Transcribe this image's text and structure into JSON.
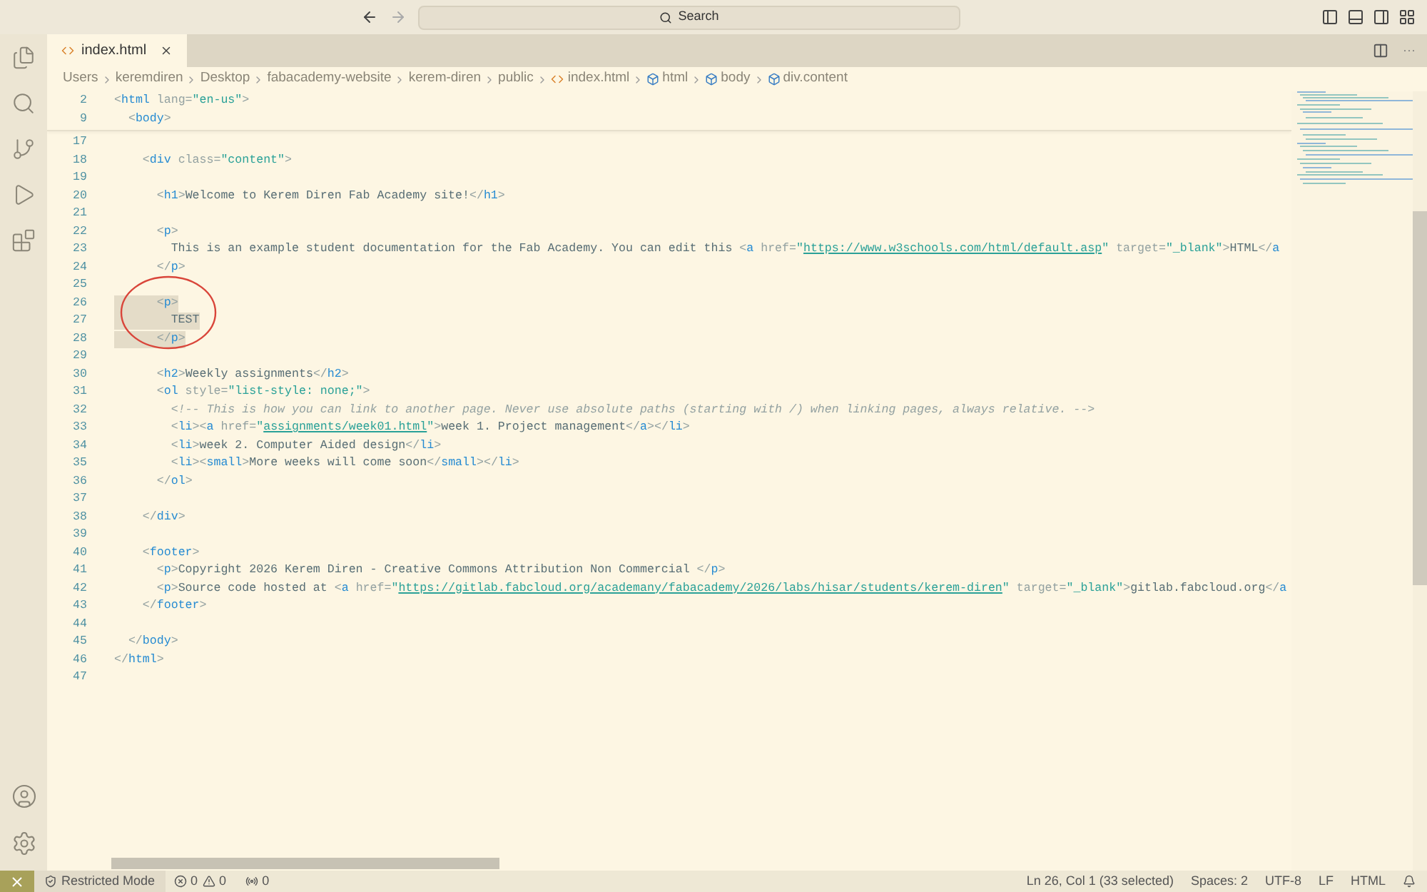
{
  "title_bar": {
    "search": {
      "placeholder": "Search"
    }
  },
  "tabs": [
    {
      "label": "index.html",
      "selected": true
    }
  ],
  "tab_actions": {
    "more": "···"
  },
  "breadcrumbs": [
    {
      "kind": "folder",
      "label": "Users"
    },
    {
      "kind": "folder",
      "label": "keremdiren"
    },
    {
      "kind": "folder",
      "label": "Desktop"
    },
    {
      "kind": "folder",
      "label": "fabacademy-website"
    },
    {
      "kind": "folder",
      "label": "kerem-diren"
    },
    {
      "kind": "folder",
      "label": "public"
    },
    {
      "kind": "file",
      "label": "index.html"
    },
    {
      "kind": "symbol",
      "label": "html"
    },
    {
      "kind": "symbol",
      "label": "body"
    },
    {
      "kind": "symbol",
      "label": "div.content"
    }
  ],
  "sticky_lines": [
    {
      "number": "2",
      "tokens": [
        {
          "kind": "punct",
          "text": "<"
        },
        {
          "kind": "tag",
          "text": "html"
        },
        {
          "kind": "attr",
          "text": " lang="
        },
        {
          "kind": "str",
          "text": "\"en-us\""
        },
        {
          "kind": "punct",
          "text": ">"
        }
      ]
    },
    {
      "number": "9",
      "tokens": [
        {
          "kind": "punct",
          "text": "  <"
        },
        {
          "kind": "tag",
          "text": "body"
        },
        {
          "kind": "punct",
          "text": ">"
        }
      ]
    }
  ],
  "lines": [
    {
      "number": "17",
      "selected": false
    },
    {
      "number": "18",
      "selected": false,
      "tokens": [
        {
          "kind": "punct",
          "text": "    <"
        },
        {
          "kind": "tag",
          "text": "div"
        },
        {
          "kind": "attr",
          "text": " class="
        },
        {
          "kind": "str",
          "text": "\"content\""
        },
        {
          "kind": "punct",
          "text": ">"
        }
      ]
    },
    {
      "number": "19",
      "selected": false
    },
    {
      "number": "20",
      "selected": false,
      "tokens": [
        {
          "kind": "punct",
          "text": "      <"
        },
        {
          "kind": "tag",
          "text": "h1"
        },
        {
          "kind": "punct",
          "text": ">"
        },
        {
          "kind": "text",
          "text": "Welcome to Kerem Diren Fab Academy site!"
        },
        {
          "kind": "punct",
          "text": "</"
        },
        {
          "kind": "tag",
          "text": "h1"
        },
        {
          "kind": "punct",
          "text": ">"
        }
      ]
    },
    {
      "number": "21",
      "selected": false
    },
    {
      "number": "22",
      "selected": false,
      "tokens": [
        {
          "kind": "punct",
          "text": "      <"
        },
        {
          "kind": "tag",
          "text": "p"
        },
        {
          "kind": "punct",
          "text": ">"
        }
      ]
    },
    {
      "number": "23",
      "selected": false,
      "tokens": [
        {
          "kind": "text",
          "text": "        This is an example student documentation for the Fab Academy. You can edit this "
        },
        {
          "kind": "punct",
          "text": "<"
        },
        {
          "kind": "tag",
          "text": "a"
        },
        {
          "kind": "attr",
          "text": " href="
        },
        {
          "kind": "str",
          "text": "\""
        },
        {
          "kind": "link",
          "text": "https://www.w3schools.com/html/default.asp"
        },
        {
          "kind": "str",
          "text": "\""
        },
        {
          "kind": "attr",
          "text": " target="
        },
        {
          "kind": "str",
          "text": "\"_blank\""
        },
        {
          "kind": "punct",
          "text": ">"
        },
        {
          "kind": "text",
          "text": "HTML"
        },
        {
          "kind": "punct",
          "text": "</"
        },
        {
          "kind": "tag",
          "text": "a"
        }
      ]
    },
    {
      "number": "24",
      "selected": false,
      "tokens": [
        {
          "kind": "punct",
          "text": "      </"
        },
        {
          "kind": "tag",
          "text": "p"
        },
        {
          "kind": "punct",
          "text": ">"
        }
      ]
    },
    {
      "number": "25",
      "selected": false
    },
    {
      "number": "26",
      "selected": true,
      "tokens": [
        {
          "kind": "punct",
          "text": "      <"
        },
        {
          "kind": "tag",
          "text": "p"
        },
        {
          "kind": "punct",
          "text": ">"
        }
      ]
    },
    {
      "number": "27",
      "selected": true,
      "tokens": [
        {
          "kind": "text",
          "text": "        TEST"
        }
      ]
    },
    {
      "number": "28",
      "selected": true,
      "tokens": [
        {
          "kind": "punct",
          "text": "      </"
        },
        {
          "kind": "tag",
          "text": "p"
        },
        {
          "kind": "punct",
          "text": ">"
        }
      ]
    },
    {
      "number": "29",
      "selected": false
    },
    {
      "number": "30",
      "selected": false,
      "tokens": [
        {
          "kind": "punct",
          "text": "      <"
        },
        {
          "kind": "tag",
          "text": "h2"
        },
        {
          "kind": "punct",
          "text": ">"
        },
        {
          "kind": "text",
          "text": "Weekly assignments"
        },
        {
          "kind": "punct",
          "text": "</"
        },
        {
          "kind": "tag",
          "text": "h2"
        },
        {
          "kind": "punct",
          "text": ">"
        }
      ]
    },
    {
      "number": "31",
      "selected": false,
      "tokens": [
        {
          "kind": "punct",
          "text": "      <"
        },
        {
          "kind": "tag",
          "text": "ol"
        },
        {
          "kind": "attr",
          "text": " style="
        },
        {
          "kind": "str",
          "text": "\"list-style: none;\""
        },
        {
          "kind": "punct",
          "text": ">"
        }
      ]
    },
    {
      "number": "32",
      "selected": false,
      "tokens": [
        {
          "kind": "comment",
          "text": "        <!-- This is how you can link to another page. Never use absolute paths (starting with /) when linking pages, always relative. -->"
        }
      ]
    },
    {
      "number": "33",
      "selected": false,
      "tokens": [
        {
          "kind": "punct",
          "text": "        <"
        },
        {
          "kind": "tag",
          "text": "li"
        },
        {
          "kind": "punct",
          "text": "><"
        },
        {
          "kind": "tag",
          "text": "a"
        },
        {
          "kind": "attr",
          "text": " href="
        },
        {
          "kind": "str",
          "text": "\""
        },
        {
          "kind": "link",
          "text": "assignments/week01.html"
        },
        {
          "kind": "str",
          "text": "\""
        },
        {
          "kind": "punct",
          "text": ">"
        },
        {
          "kind": "text",
          "text": "week 1. Project management"
        },
        {
          "kind": "punct",
          "text": "</"
        },
        {
          "kind": "tag",
          "text": "a"
        },
        {
          "kind": "punct",
          "text": "></"
        },
        {
          "kind": "tag",
          "text": "li"
        },
        {
          "kind": "punct",
          "text": ">"
        }
      ]
    },
    {
      "number": "34",
      "selected": false,
      "tokens": [
        {
          "kind": "punct",
          "text": "        <"
        },
        {
          "kind": "tag",
          "text": "li"
        },
        {
          "kind": "punct",
          "text": ">"
        },
        {
          "kind": "text",
          "text": "week 2. Computer Aided design"
        },
        {
          "kind": "punct",
          "text": "</"
        },
        {
          "kind": "tag",
          "text": "li"
        },
        {
          "kind": "punct",
          "text": ">"
        }
      ]
    },
    {
      "number": "35",
      "selected": false,
      "tokens": [
        {
          "kind": "punct",
          "text": "        <"
        },
        {
          "kind": "tag",
          "text": "li"
        },
        {
          "kind": "punct",
          "text": "><"
        },
        {
          "kind": "tag",
          "text": "small"
        },
        {
          "kind": "punct",
          "text": ">"
        },
        {
          "kind": "text",
          "text": "More weeks will come soon"
        },
        {
          "kind": "punct",
          "text": "</"
        },
        {
          "kind": "tag",
          "text": "small"
        },
        {
          "kind": "punct",
          "text": "></"
        },
        {
          "kind": "tag",
          "text": "li"
        },
        {
          "kind": "punct",
          "text": ">"
        }
      ]
    },
    {
      "number": "36",
      "selected": false,
      "tokens": [
        {
          "kind": "punct",
          "text": "      </"
        },
        {
          "kind": "tag",
          "text": "ol"
        },
        {
          "kind": "punct",
          "text": ">"
        }
      ]
    },
    {
      "number": "37",
      "selected": false
    },
    {
      "number": "38",
      "selected": false,
      "tokens": [
        {
          "kind": "punct",
          "text": "    </"
        },
        {
          "kind": "tag",
          "text": "div"
        },
        {
          "kind": "punct",
          "text": ">"
        }
      ]
    },
    {
      "number": "39",
      "selected": false
    },
    {
      "number": "40",
      "selected": false,
      "tokens": [
        {
          "kind": "punct",
          "text": "    <"
        },
        {
          "kind": "tag",
          "text": "footer"
        },
        {
          "kind": "punct",
          "text": ">"
        }
      ]
    },
    {
      "number": "41",
      "selected": false,
      "tokens": [
        {
          "kind": "punct",
          "text": "      <"
        },
        {
          "kind": "tag",
          "text": "p"
        },
        {
          "kind": "punct",
          "text": ">"
        },
        {
          "kind": "text",
          "text": "Copyright 2026 Kerem Diren - Creative Commons Attribution Non Commercial "
        },
        {
          "kind": "punct",
          "text": "</"
        },
        {
          "kind": "tag",
          "text": "p"
        },
        {
          "kind": "punct",
          "text": ">"
        }
      ]
    },
    {
      "number": "42",
      "selected": false,
      "tokens": [
        {
          "kind": "punct",
          "text": "      <"
        },
        {
          "kind": "tag",
          "text": "p"
        },
        {
          "kind": "punct",
          "text": ">"
        },
        {
          "kind": "text",
          "text": "Source code hosted at "
        },
        {
          "kind": "punct",
          "text": "<"
        },
        {
          "kind": "tag",
          "text": "a"
        },
        {
          "kind": "attr",
          "text": " href="
        },
        {
          "kind": "str",
          "text": "\""
        },
        {
          "kind": "link",
          "text": "https://gitlab.fabcloud.org/academany/fabacademy/2026/labs/hisar/students/kerem-diren"
        },
        {
          "kind": "str",
          "text": "\""
        },
        {
          "kind": "attr",
          "text": " target="
        },
        {
          "kind": "str",
          "text": "\"_blank\""
        },
        {
          "kind": "punct",
          "text": ">"
        },
        {
          "kind": "text",
          "text": "gitlab.fabcloud.org"
        },
        {
          "kind": "punct",
          "text": "</"
        },
        {
          "kind": "tag",
          "text": "a"
        }
      ]
    },
    {
      "number": "43",
      "selected": false,
      "tokens": [
        {
          "kind": "punct",
          "text": "    </"
        },
        {
          "kind": "tag",
          "text": "footer"
        },
        {
          "kind": "punct",
          "text": ">"
        }
      ]
    },
    {
      "number": "44",
      "selected": false
    },
    {
      "number": "45",
      "selected": false,
      "tokens": [
        {
          "kind": "punct",
          "text": "  </"
        },
        {
          "kind": "tag",
          "text": "body"
        },
        {
          "kind": "punct",
          "text": ">"
        }
      ]
    },
    {
      "number": "46",
      "selected": false,
      "tokens": [
        {
          "kind": "punct",
          "text": "</"
        },
        {
          "kind": "tag",
          "text": "html"
        },
        {
          "kind": "punct",
          "text": ">"
        }
      ]
    },
    {
      "number": "47",
      "selected": false
    }
  ],
  "status_bar": {
    "mode": "Restricted Mode",
    "errors": "0",
    "warnings": "0",
    "ports": "0",
    "position": "Ln 26, Col 1 (33 selected)",
    "spaces": "Spaces: 2",
    "encoding": "UTF-8",
    "eol": "LF",
    "language": "HTML"
  }
}
